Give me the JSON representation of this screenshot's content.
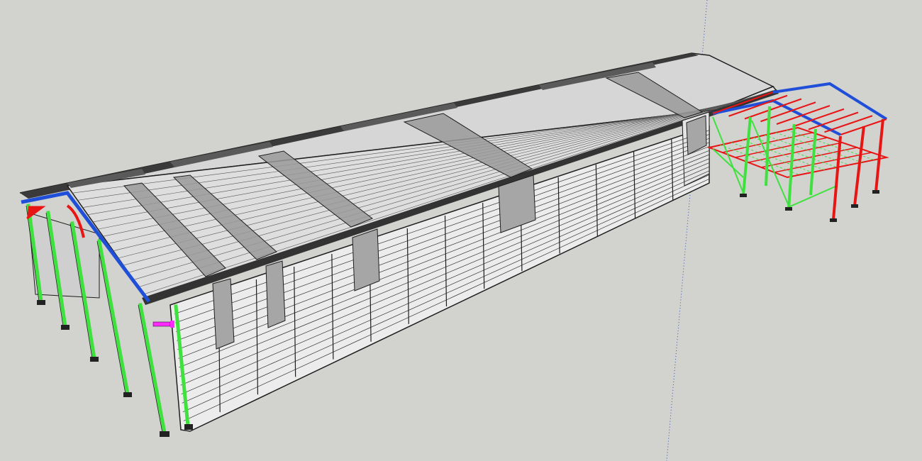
{
  "app": {
    "viewport": "3D model view"
  },
  "scene": {
    "background_color": "#d2d2cf",
    "model": "steel-frame-building-with-annex",
    "colors": {
      "wall_cladding": "#ececec",
      "roof_sheet": "#dcdcdc",
      "roof_translucent": "#9a9a9a",
      "roof_ridge": "#4a4a4a",
      "outline": "#1e1e1e",
      "opening": "#a6a6a6",
      "column": "#3fe13f",
      "bracing": "#3fe13f",
      "rafter": "#1f4fd8",
      "red_member": "#e81515",
      "floor_beam": "#e81515",
      "pink_marker": "#ff2aff",
      "axis_blue": "#3a4fb8"
    }
  }
}
